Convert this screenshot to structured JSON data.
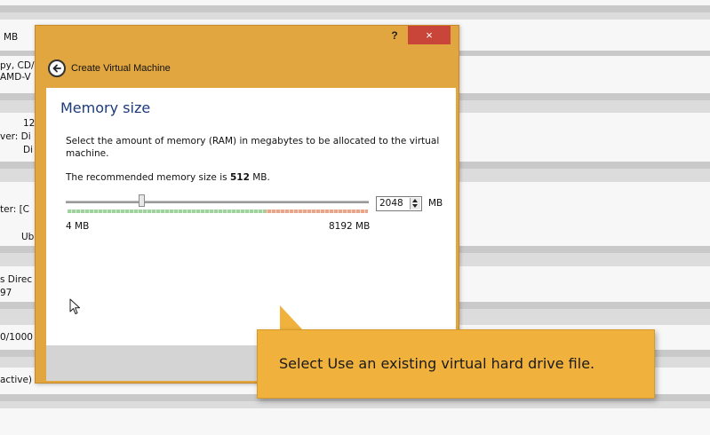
{
  "background": {
    "texts": [
      "MB",
      "py, CD/",
      "AMD-V",
      "12",
      "ver:  Di",
      "Di",
      "ter:  [C",
      "Ub",
      "s Direc",
      "97",
      "0/1000",
      "active)"
    ]
  },
  "dialog": {
    "help_label": "?",
    "close_label": "×",
    "title": "Create Virtual Machine",
    "section_title": "Memory size",
    "description": "Select the amount of memory (RAM) in megabytes to be allocated to the virtual machine.",
    "recommended_prefix": "The recommended memory size is",
    "recommended_value": "512",
    "recommended_unit": "MB.",
    "memory_value": "2048",
    "memory_unit": "MB",
    "min_label": "4 MB",
    "max_label": "8192 MB",
    "slider_fraction": 0.25
  },
  "callout": {
    "text": "Select Use an existing virtual hard drive file."
  },
  "colors": {
    "dialog_frame": "#e2a640",
    "close_button": "#c9453a",
    "heading": "#1d3a7a",
    "callout": "#f1b23d"
  },
  "icons": [
    "back-arrow-icon",
    "mouse-cursor-icon",
    "spin-up-icon",
    "spin-down-icon"
  ]
}
